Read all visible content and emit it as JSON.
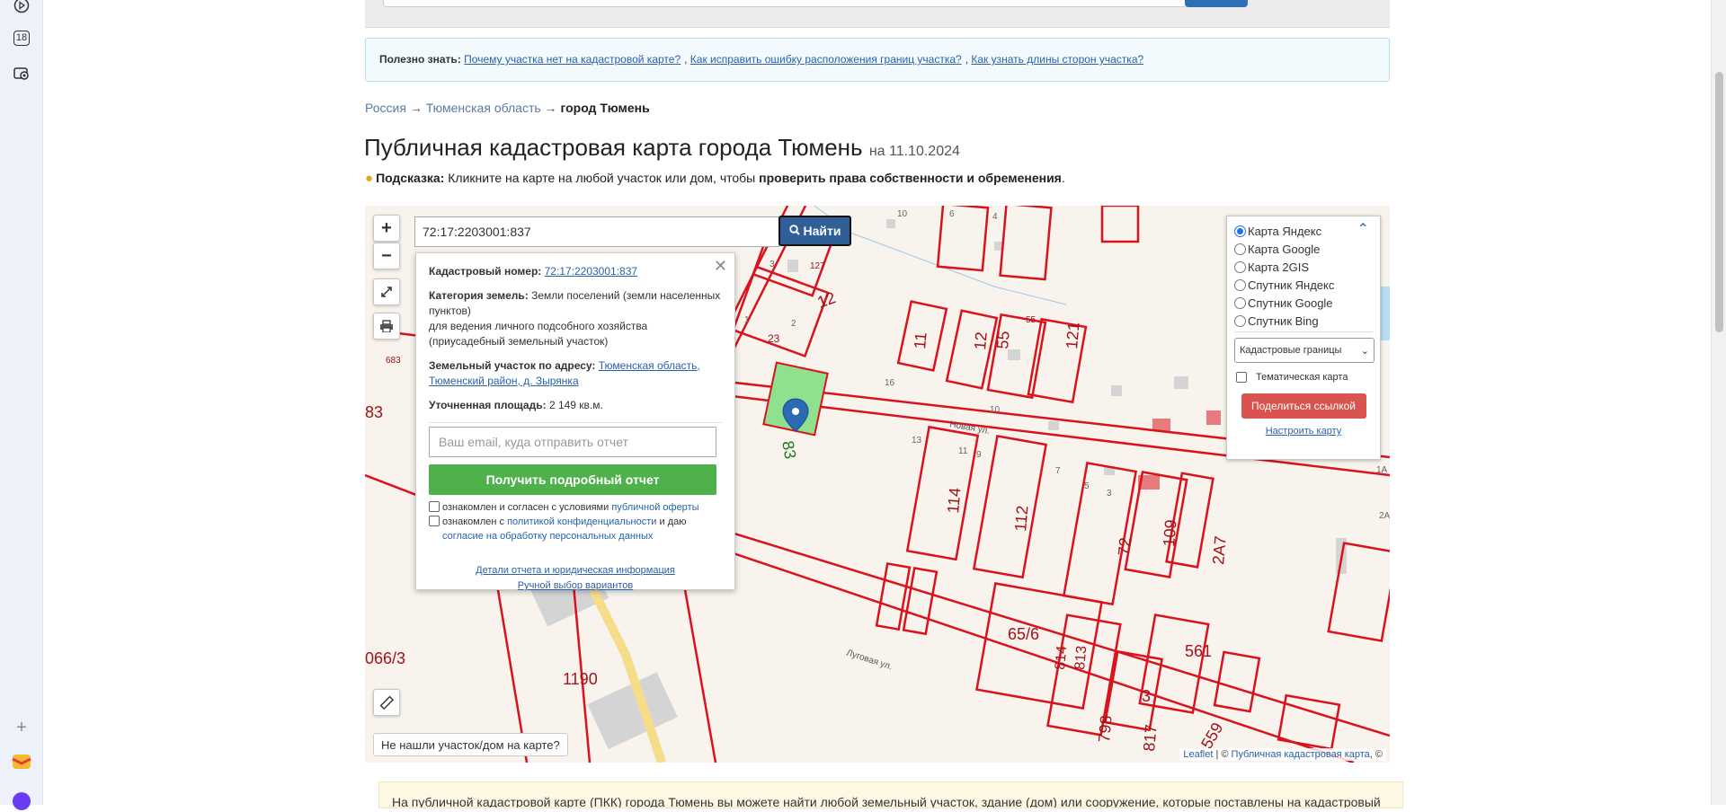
{
  "useful": {
    "label": "Полезно знать:",
    "links": [
      "Почему участка нет на кадастровой карте?",
      "Как исправить ошибку расположения границ участка?",
      "Как узнать длины сторон участка?"
    ]
  },
  "breadcrumb": {
    "items": [
      "Россия",
      "Тюменская область"
    ],
    "current": "город Тюмень",
    "separator": "→"
  },
  "title": {
    "text": "Публичная кадастровая карта города Тюмень",
    "date": "на 11.10.2024"
  },
  "hint": {
    "label": "Подсказка:",
    "text": "Кликните на карте на любой участок или дом, чтобы",
    "bold": "проверить права собственности и обременения",
    "end": "."
  },
  "search": {
    "value": "72:17:2203001:837",
    "button": "Найти"
  },
  "zoom": {
    "in": "+",
    "out": "−"
  },
  "popup": {
    "cad_label": "Кадастровый номер:",
    "cad_value": "72:17:2203001:837",
    "category_label": "Категория земель:",
    "category_value": "Земли поселений (земли населенных пунктов)",
    "usage": "для ведения личного подсобного хозяйства (приусадебный земельный участок)",
    "address_label": "Земельный участок по адресу:",
    "address_value": "Тюменская область, Тюменский район, д. Зырянка",
    "area_label": "Уточненная площадь:",
    "area_value": "2 149 кв.м.",
    "email_placeholder": "Ваш email, куда отправить отчет",
    "report_button": "Получить подробный отчет",
    "agree1_text": "ознакомлен и согласен с условиями",
    "agree1_link": "публичной оферты",
    "agree2_text": "ознакомлен с",
    "agree2_link": "политикой конфиденциальности",
    "agree2_and": "и даю",
    "agree2_link2": "согласие на обработку персональных данных",
    "details_link": "Детали отчета и юридическая информация",
    "manual_link": "Ручной выбор вариантов",
    "close": "✕"
  },
  "layers": {
    "options": [
      "Карта Яндекс",
      "Карта Google",
      "Карта 2GIS",
      "Спутник Яндекс",
      "Спутник Google",
      "Спутник Bing"
    ],
    "selected": "Карта Яндекс",
    "select_value": "Кадастровые границы",
    "thematic": "Тематическая карта",
    "share": "Поделиться ссылкой",
    "customize": "Настроить карту"
  },
  "not_found": "Не нашли участок/дом на карте?",
  "attribution": {
    "leaflet": "Leaflet",
    "sep": " | © ",
    "source": "Публичная кадастровая карта",
    "end": ", ©"
  },
  "sidebar": {
    "badge": "18"
  },
  "map_labels": {
    "plots": [
      "83",
      "1190",
      "066/3",
      "683",
      "83",
      "114",
      "112",
      "72",
      "109",
      "2А7",
      "65/6",
      "814",
      "813",
      "798",
      "3",
      "817",
      "561",
      "559",
      "55",
      "121",
      "12",
      "11",
      "127",
      "12",
      "23",
      "16"
    ],
    "streets": [
      "Новая ул.",
      "Луговая ул."
    ],
    "small": [
      "10",
      "6",
      "4",
      "3",
      "7",
      "2",
      "1",
      "16",
      "13",
      "11",
      "9",
      "10",
      "7",
      "5",
      "3",
      "1А",
      "2А"
    ]
  },
  "bottom_text": "На публичной кадастровой карте (ПКК) города Тюмень вы можете найти любой земельный участок, здание (дом) или сооружение, которые поставлены на кадастровый",
  "colors": {
    "plot_border": "#d9121d",
    "selected_fill": "#8fe08f",
    "accent": "#2f5f96",
    "green_button": "#4fb14b",
    "red_button": "#d9534f"
  }
}
